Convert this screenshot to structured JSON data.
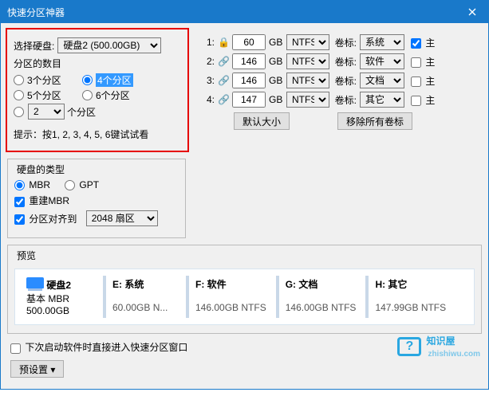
{
  "title": "快速分区神器",
  "left": {
    "diskLabel": "选择硬盘:",
    "diskOptions": [
      "硬盘2 (500.00GB)"
    ],
    "diskSelected": "硬盘2 (500.00GB)",
    "countLabel": "分区的数目",
    "opts": {
      "p3": "3个分区",
      "p4": "4个分区",
      "p5": "5个分区",
      "p6": "6个分区",
      "customSel": "2",
      "customSuffix": "个分区"
    },
    "hint": "提示：按1, 2, 3, 4, 5, 6键试试看"
  },
  "rows": [
    {
      "n": "1:",
      "locked": true,
      "size": "60",
      "gb": "GB",
      "fs": "NTFS",
      "vlab": "卷标:",
      "vname": "系统",
      "pri": true
    },
    {
      "n": "2:",
      "locked": false,
      "size": "146",
      "gb": "GB",
      "fs": "NTFS",
      "vlab": "卷标:",
      "vname": "软件",
      "pri": false
    },
    {
      "n": "3:",
      "locked": false,
      "size": "146",
      "gb": "GB",
      "fs": "NTFS",
      "vlab": "卷标:",
      "vname": "文档",
      "pri": false
    },
    {
      "n": "4:",
      "locked": false,
      "size": "147",
      "gb": "GB",
      "fs": "NTFS",
      "vlab": "卷标:",
      "vname": "其它",
      "pri": false
    }
  ],
  "priLabel": "主",
  "btnDefault": "默认大小",
  "btnClear": "移除所有卷标",
  "diskType": {
    "legend": "硬盘的类型",
    "mbr": "MBR",
    "gpt": "GPT",
    "rebuild": "重建MBR",
    "alignLabel": "分区对齐到",
    "alignSel": "2048 扇区"
  },
  "preview": {
    "legend": "预览",
    "disk": {
      "name": "硬盘2",
      "type": "基本 MBR",
      "size": "500.00GB"
    },
    "parts": [
      {
        "label": "E: 系统",
        "size": "60.00GB N..."
      },
      {
        "label": "F: 软件",
        "size": "146.00GB NTFS"
      },
      {
        "label": "G: 文档",
        "size": "146.00GB NTFS"
      },
      {
        "label": "H: 其它",
        "size": "147.99GB NTFS"
      }
    ]
  },
  "footer": {
    "startup": "下次启动软件时直接进入快速分区窗口",
    "preset": "预设置"
  },
  "brand": {
    "name": "知识屋",
    "url": "zhishiwu.com"
  }
}
